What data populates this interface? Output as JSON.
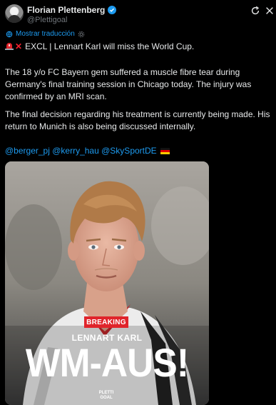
{
  "author": {
    "name": "Florian Plettenberg",
    "handle": "@Plettigoal"
  },
  "translation": {
    "label": "Mostrar traducción"
  },
  "tweet": {
    "headline": "EXCL | Lennart Karl will miss the World Cup.",
    "paragraph1": "The 18 y/o FC Bayern gem suffered a muscle fibre tear during Germany's final training session in Chicago today. The injury was confirmed by an MRI scan.",
    "paragraph2": "The final decision regarding his treatment is currently being made. His return to Munich is also being discussed internally.",
    "mentions": [
      "@berger_pj",
      "@kerry_hau",
      "@SkySportDE"
    ]
  },
  "media": {
    "badge": "BREAKING",
    "player_name": "LENNART KARL",
    "headline": "WM-AUS!",
    "logo_text": [
      "PLETTI",
      "GOAL"
    ]
  },
  "colors": {
    "background": "#000000",
    "text": "#e7e9ea",
    "accent": "#1d9bf0",
    "breaking_red": "#e0242b"
  },
  "icons": [
    "refresh-icon",
    "close-icon",
    "verified-badge-icon",
    "translate-gear-icon",
    "siren-emoji-icon",
    "cross-mark-emoji-icon",
    "germany-flag-icon"
  ]
}
